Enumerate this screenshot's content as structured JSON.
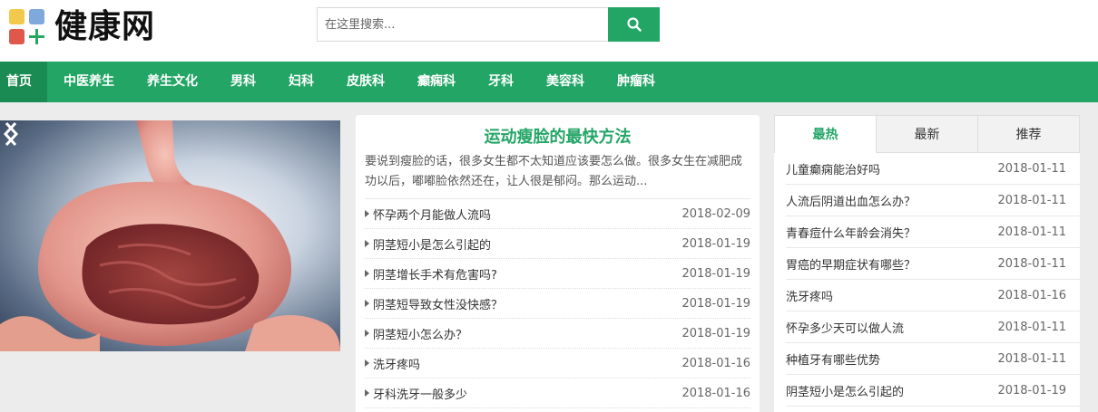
{
  "header": {
    "logo_text": "健康网",
    "search_placeholder": "在这里搜索...",
    "search_icon": "search-icon"
  },
  "nav": {
    "items": [
      {
        "label": "首页"
      },
      {
        "label": "中医养生"
      },
      {
        "label": "养生文化"
      },
      {
        "label": "男科"
      },
      {
        "label": "妇科"
      },
      {
        "label": "皮肤科"
      },
      {
        "label": "癫痫科"
      },
      {
        "label": "牙科"
      },
      {
        "label": "美容科"
      },
      {
        "label": "肿瘤科"
      }
    ]
  },
  "featured": {
    "title": "运动瘦脸的最快方法",
    "desc": "要说到瘦脸的话，很多女生都不太知道应该要怎么做。很多女生在减肥成功以后，嘟嘟脸依然还在，让人很是郁闷。那么运动..."
  },
  "article_list": [
    {
      "title": "怀孕两个月能做人流吗",
      "date": "2018-02-09"
    },
    {
      "title": "阴茎短小是怎么引起的",
      "date": "2018-01-19"
    },
    {
      "title": "阴茎增长手术有危害吗?",
      "date": "2018-01-19"
    },
    {
      "title": "阴茎短导致女性没快感？",
      "date": "2018-01-19"
    },
    {
      "title": "阴茎短小怎么办？",
      "date": "2018-01-19"
    },
    {
      "title": "洗牙疼吗",
      "date": "2018-01-16"
    },
    {
      "title": "牙科洗牙一般多少",
      "date": "2018-01-16"
    }
  ],
  "tabs": [
    {
      "label": "最热"
    },
    {
      "label": "最新"
    },
    {
      "label": "推荐"
    }
  ],
  "hot_list": [
    {
      "title": "儿童癫痫能治好吗",
      "date": "2018-01-11"
    },
    {
      "title": "人流后阴道出血怎么办？",
      "date": "2018-01-11"
    },
    {
      "title": "青春痘什么年龄会消失？",
      "date": "2018-01-11"
    },
    {
      "title": "胃癌的早期症状有哪些？",
      "date": "2018-01-11"
    },
    {
      "title": "洗牙疼吗",
      "date": "2018-01-16"
    },
    {
      "title": "怀孕多少天可以做人流",
      "date": "2018-01-11"
    },
    {
      "title": "种植牙有哪些优势",
      "date": "2018-01-11"
    },
    {
      "title": "阴茎短小是怎么引起的",
      "date": "2018-01-19"
    }
  ],
  "colors": {
    "brand_green": "#23a566",
    "nav_active": "#1a8b52"
  }
}
